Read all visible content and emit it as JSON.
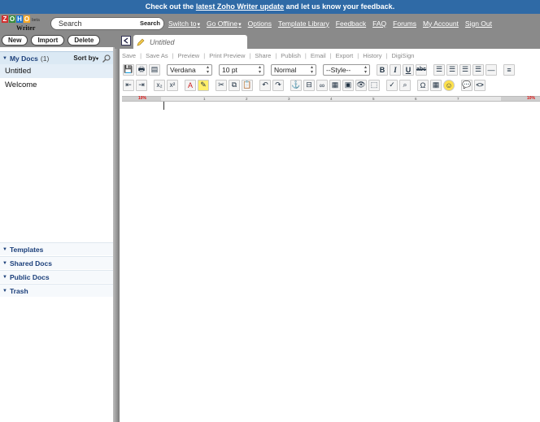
{
  "banner": {
    "prefix": "Check out the ",
    "link": "latest Zoho Writer update",
    "suffix": " and let us know your feedback."
  },
  "logo": {
    "letters": [
      "Z",
      "O",
      "H",
      "O"
    ],
    "letter_colors": [
      "#d32f2f",
      "#388e3c",
      "#1976d2",
      "#f9a825"
    ],
    "beta": "beta",
    "product": "Writer"
  },
  "search": {
    "value": "Search",
    "button": "Search"
  },
  "toplinks": [
    {
      "label": "Switch to",
      "has_arrow": true
    },
    {
      "label": "Go Offline",
      "has_arrow": true
    },
    {
      "label": "Options",
      "has_arrow": false
    },
    {
      "label": "Template Library",
      "has_arrow": false
    },
    {
      "label": "Feedback",
      "has_arrow": false
    },
    {
      "label": "FAQ",
      "has_arrow": false
    },
    {
      "label": "Forums",
      "has_arrow": false
    },
    {
      "label": "My Account",
      "has_arrow": false
    },
    {
      "label": "Sign Out",
      "has_arrow": false
    }
  ],
  "actions": {
    "new": "New",
    "import": "Import",
    "delete": "Delete"
  },
  "mydocs": {
    "title": "My Docs",
    "count": "(1)",
    "sortby": "Sort by",
    "items": [
      "Untitled",
      "Welcome"
    ]
  },
  "sections": [
    "Templates",
    "Shared Docs",
    "Public Docs",
    "Trash"
  ],
  "tab": {
    "label": "Untitled"
  },
  "menu": [
    "Save",
    "Save As",
    "Preview",
    "Print Preview",
    "Share",
    "Publish",
    "Email",
    "Export",
    "History",
    "DigiSign"
  ],
  "format": {
    "font": "Verdana",
    "size": "10 pt",
    "paragraph": "Normal",
    "style": "--Style--"
  },
  "ruler": {
    "left_pct": "10%",
    "right_pct": "10%",
    "ticks": [
      "1",
      "2",
      "3",
      "4",
      "5",
      "6",
      "7"
    ]
  }
}
